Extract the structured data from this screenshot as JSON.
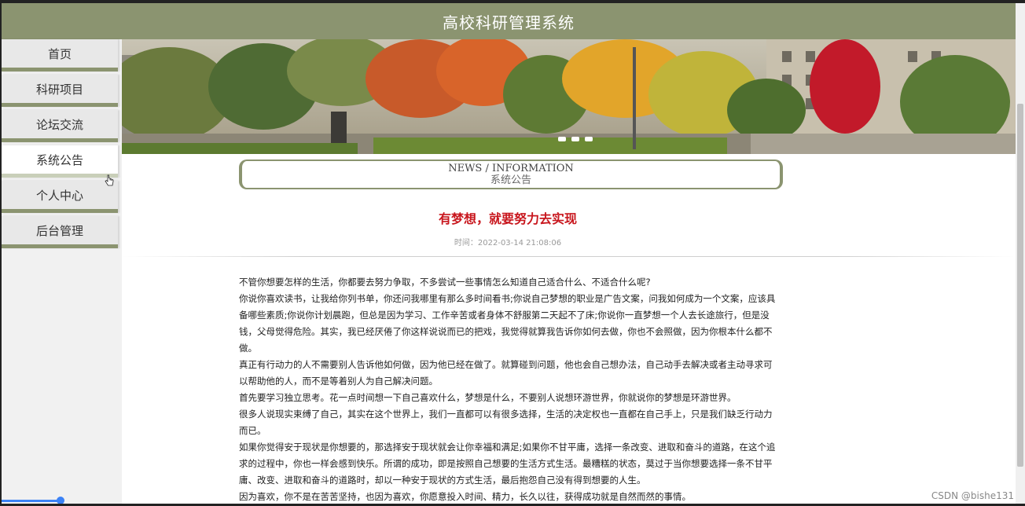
{
  "header": {
    "title": "高校科研管理系统"
  },
  "sidebar": {
    "items": [
      {
        "label": "首页",
        "active": false
      },
      {
        "label": "科研项目",
        "active": false
      },
      {
        "label": "论坛交流",
        "active": false
      },
      {
        "label": "系统公告",
        "active": true
      },
      {
        "label": "个人中心",
        "active": false
      },
      {
        "label": "后台管理",
        "active": false
      }
    ]
  },
  "section": {
    "title_en": "NEWS / INFORMATION",
    "title_cn": "系统公告"
  },
  "article": {
    "title": "有梦想，就要努力去实现",
    "time": "时间：2022-03-14 21:08:06",
    "paragraphs": [
      "不管你想要怎样的生活，你都要去努力争取，不多尝试一些事情怎么知道自己适合什么、不适合什么呢?",
      "你说你喜欢读书，让我给你列书单，你还问我哪里有那么多时间看书;你说自己梦想的职业是广告文案，问我如何成为一个文案，应该具备哪些素质;你说你计划晨跑，但总是因为学习、工作辛苦或者身体不舒服第二天起不了床;你说你一直梦想一个人去长途旅行，但是没钱，父母觉得危险。其实，我已经厌倦了你这样说说而已的把戏，我觉得就算我告诉你如何去做，你也不会照做，因为你根本什么都不做。",
      "真正有行动力的人不需要别人告诉他如何做，因为他已经在做了。就算碰到问题，他也会自己想办法，自己动手去解决或者主动寻求可以帮助他的人，而不是等着别人为自己解决问题。",
      "首先要学习独立思考。花一点时间想一下自己喜欢什么，梦想是什么，不要别人说想环游世界，你就说你的梦想是环游世界。",
      "很多人说现实束缚了自己，其实在这个世界上，我们一直都可以有很多选择，生活的决定权也一直都在自己手上，只是我们缺乏行动力而已。",
      "如果你觉得安于现状是你想要的，那选择安于现状就会让你幸福和满足;如果你不甘平庸，选择一条改变、进取和奋斗的道路，在这个追求的过程中，你也一样会感到快乐。所谓的成功，即是按照自己想要的生活方式生活。最糟糕的状态，莫过于当你想要选择一条不甘平庸、改变、进取和奋斗的道路时，却以一种安于现状的方式生活，最后抱怨自己没有得到想要的人生。",
      "因为喜欢，你不是在苦苦坚持，也因为喜欢，你愿意投入时间、精力，长久以往，获得成功就是自然而然的事情。"
    ]
  },
  "watermark": "CSDN @bishe131",
  "colors": {
    "header_bg": "#8b9470",
    "accent": "#8b9470",
    "title_red": "#c8161d"
  }
}
